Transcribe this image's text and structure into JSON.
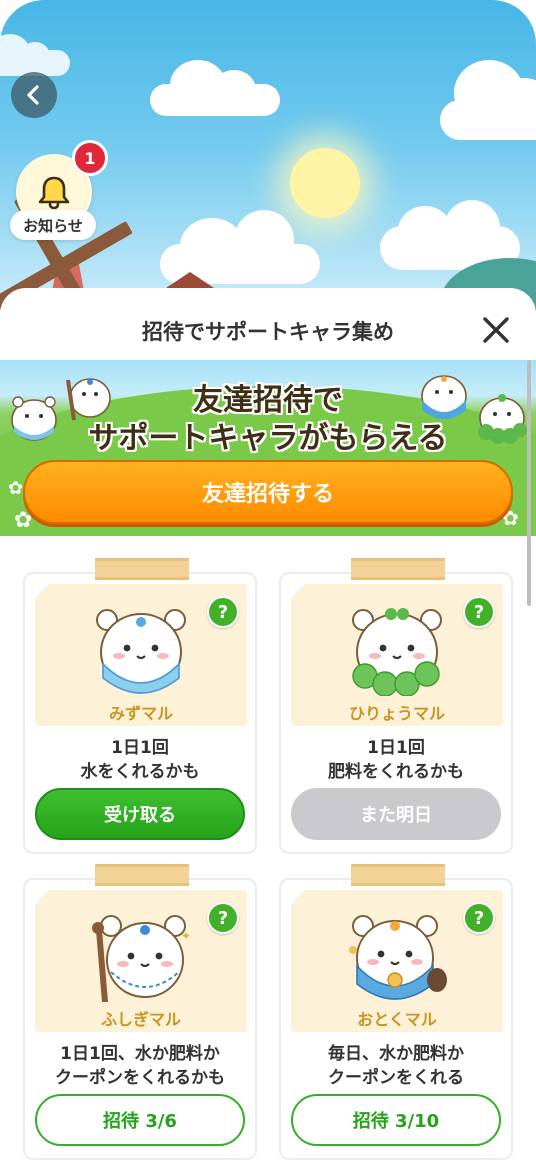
{
  "header": {
    "back_label": "",
    "notification": {
      "label": "お知らせ",
      "count": "1"
    }
  },
  "sheet": {
    "title": "招待でサポートキャラ集め",
    "banner": {
      "line1": "友達招待で",
      "line2": "サポートキャラがもらえる",
      "cta_label": "友達招待する"
    }
  },
  "cards": [
    {
      "name": "みずマル",
      "desc_line1": "1日1回",
      "desc_line2": "水をくれるかも",
      "button": "受け取る",
      "help": "?"
    },
    {
      "name": "ひりょうマル",
      "desc_line1": "1日1回",
      "desc_line2": "肥料をくれるかも",
      "button": "また明日",
      "help": "?"
    },
    {
      "name": "ふしぎマル",
      "desc_line1": "1日1回、水か肥料か",
      "desc_line2": "クーポンをくれるかも",
      "button": "招待 3/6",
      "help": "?"
    },
    {
      "name": "おとくマル",
      "desc_line1": "毎日、水か肥料か",
      "desc_line2": "クーポンをくれる",
      "button": "招待 3/10",
      "help": "?"
    }
  ],
  "colors": {
    "primary_green": "#26a31a",
    "cta_orange": "#ff8a00",
    "badge_red": "#e0283a",
    "name_gold": "#c9951f"
  }
}
